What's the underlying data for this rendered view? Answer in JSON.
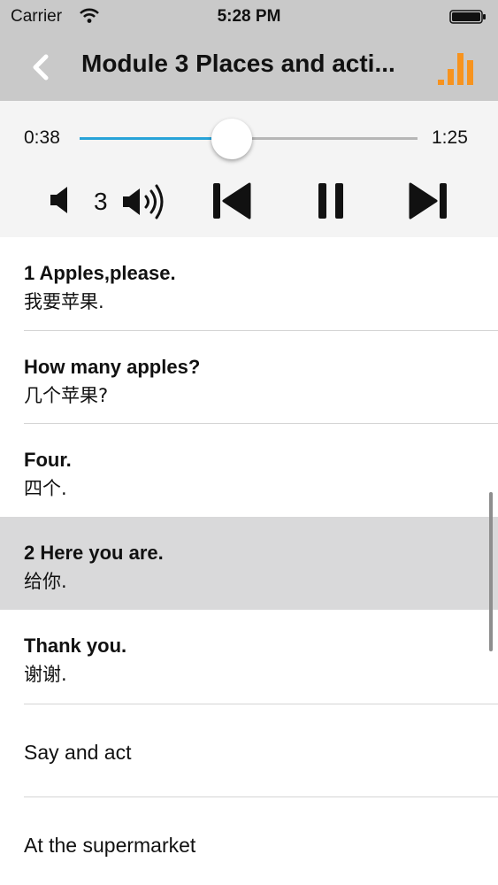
{
  "status_bar": {
    "carrier": "Carrier",
    "time": "5:28 PM",
    "icons": [
      "wifi-icon",
      "battery-icon"
    ]
  },
  "nav": {
    "title": "Module 3 Places and acti...",
    "back_icon": "chevron-left-icon",
    "right_icon": "equalizer-icon",
    "accent_color": "#f7931e"
  },
  "player": {
    "current_time": "0:38",
    "duration": "1:25",
    "progress": 0.45,
    "volume": "3",
    "track_color": "#27a3d8",
    "icons": [
      "volume-down-icon",
      "volume-up-icon",
      "previous-icon",
      "pause-icon",
      "next-icon"
    ]
  },
  "list": [
    {
      "en": "1 Apples,please.",
      "zh": "我要苹果."
    },
    {
      "en": "How many apples?",
      "zh": "几个苹果?"
    },
    {
      "en": "Four.",
      "zh": "四个."
    },
    {
      "en": "2 Here you are.",
      "zh": "给你.",
      "selected": true
    },
    {
      "en": "Thank you.",
      "zh": "谢谢."
    },
    {
      "label": "Say and act"
    },
    {
      "label": "At the supermarket"
    }
  ]
}
